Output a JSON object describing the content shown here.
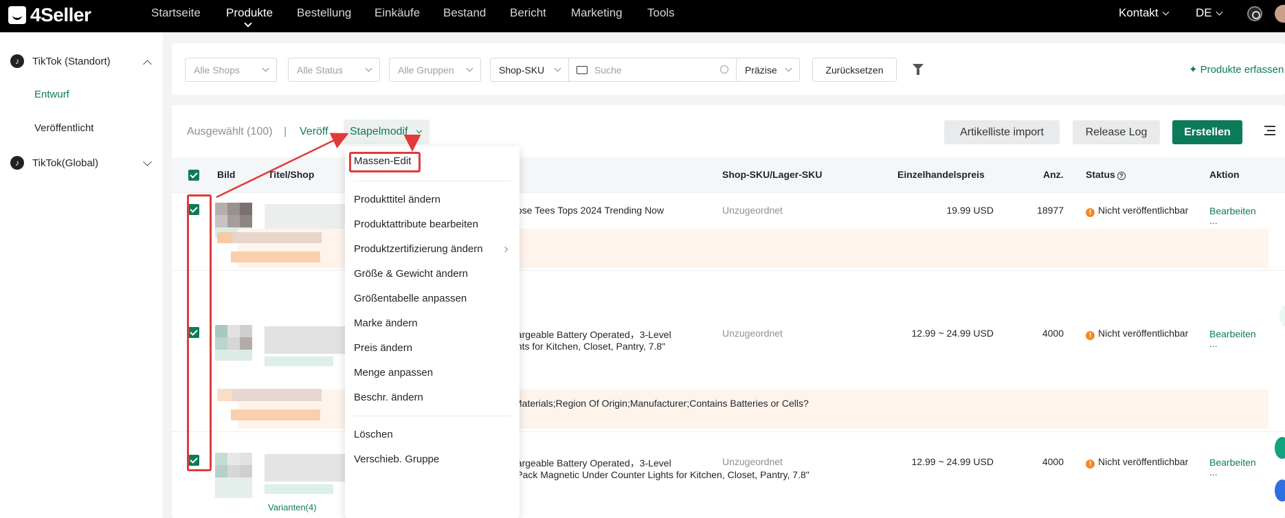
{
  "app": {
    "logo": "4Seller"
  },
  "nav": {
    "items": [
      "Startseite",
      "Produkte",
      "Bestellung",
      "Einkäufe",
      "Bestand",
      "Bericht",
      "Marketing",
      "Tools"
    ],
    "active": "Produkte",
    "kontakt": "Kontakt",
    "language": "DE"
  },
  "sidebar": {
    "groups": [
      {
        "label": "TikTok (Standort)",
        "expanded": true,
        "items": [
          "Entwurf",
          "Veröffentlicht"
        ]
      },
      {
        "label": "TikTok(Global)",
        "expanded": false,
        "items": []
      }
    ],
    "active_item": "Entwurf"
  },
  "filters": {
    "shops": "Alle Shops",
    "status": "Alle Status",
    "groups": "Alle Gruppen",
    "search_field": "Shop-SKU",
    "search_placeholder": "Suche",
    "match": "Präzise",
    "reset": "Zurücksetzen",
    "capture": "Produkte erfassen"
  },
  "toolbar": {
    "selected": "Ausgewählt (100)",
    "divider": "|",
    "publish": "Veröff",
    "batch": "Stapelmodif",
    "import": "Artikelliste import",
    "release_log": "Release Log",
    "create": "Erstellen"
  },
  "table": {
    "columns": [
      "Bild",
      "Titel/Shop",
      "Shop-SKU/Lager-SKU",
      "Einzelhandelspreis",
      "Anz.",
      "Status",
      "Aktion"
    ],
    "rows": [
      {
        "title_line1": "oose Tees Tops 2024 Trending Now",
        "title_line2": "",
        "sku": "Unzugeordnet",
        "price": "19.99 USD",
        "qty": "18977",
        "status": "Nicht veröffentlichbar",
        "action": "Bearbeiten",
        "more": "...",
        "notice": ""
      },
      {
        "title_line1": "hargeable Battery Operated，3-Level",
        "title_line2": "ghts for Kitchen, Closet, Pantry, 7.8\"",
        "sku": "Unzugeordnet",
        "price": "12.99 ~ 24.99 USD",
        "qty": "4000",
        "status": "Nicht veröffentlichbar",
        "action": "Bearbeiten",
        "more": "...",
        "notice": "Materials;Region Of Origin;Manufacturer;Contains Batteries or Cells?"
      },
      {
        "title_line1": "hargeable Battery Operated，3-Level",
        "title_line2": "ess, 3 Pack Magnetic Under Counter Lights for Kitchen, Closet, Pantry, 7.8\"",
        "sku": "Unzugeordnet",
        "price": "12.99 ~ 24.99 USD",
        "qty": "4000",
        "status": "Nicht veröffentlichbar",
        "action": "Bearbeiten",
        "more": "...",
        "notice": ""
      }
    ],
    "variants_label": "Varianten(4)"
  },
  "dropdown": {
    "highlighted": "Massen-Edit",
    "items": [
      "Produkttitel ändern",
      "Produktattribute bearbeiten",
      "Produktzertifizierung ändern",
      "Größe & Gewicht ändern",
      "Größentabelle anpassen",
      "Marke ändern",
      "Preis ändern",
      "Menge anpassen",
      "Beschr. ändern"
    ],
    "items_bottom": [
      "Löschen",
      "Verschieb. Gruppe"
    ]
  },
  "colors": {
    "brand": "#0d7b5a",
    "annotation": "#e03a3a",
    "warning": "#f08a24"
  }
}
